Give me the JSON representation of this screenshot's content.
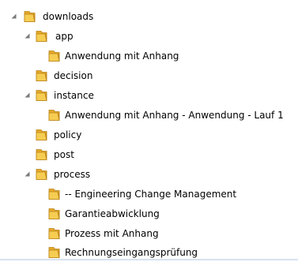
{
  "tree": {
    "nodes": [
      {
        "label": "downloads",
        "depth": 0,
        "expanded": true
      },
      {
        "label": "app",
        "depth": 1,
        "expanded": true
      },
      {
        "label": "Anwendung mit Anhang",
        "depth": 2,
        "expanded": null
      },
      {
        "label": "decision",
        "depth": 1,
        "expanded": null
      },
      {
        "label": "instance",
        "depth": 1,
        "expanded": true
      },
      {
        "label": "Anwendung mit Anhang - Anwendung - Lauf 1",
        "depth": 2,
        "expanded": null
      },
      {
        "label": "policy",
        "depth": 1,
        "expanded": null
      },
      {
        "label": "post",
        "depth": 1,
        "expanded": null
      },
      {
        "label": "process",
        "depth": 1,
        "expanded": true
      },
      {
        "label": "-- Engineering Change Management",
        "depth": 2,
        "expanded": null
      },
      {
        "label": "Garantieabwicklung",
        "depth": 2,
        "expanded": null
      },
      {
        "label": "Prozess mit Anhang",
        "depth": 2,
        "expanded": null
      },
      {
        "label": "Rechnungseingangsprüfung",
        "depth": 2,
        "expanded": null
      }
    ],
    "icons": {
      "folder": "folder-icon",
      "expander": "expand-triangle-icon"
    }
  },
  "colors": {
    "folder_front": "#f6cd52",
    "folder_back": "#e4a92a",
    "folder_outline": "#b98318",
    "expander": "#7a7a7a",
    "edge": "#d7e2f0"
  }
}
